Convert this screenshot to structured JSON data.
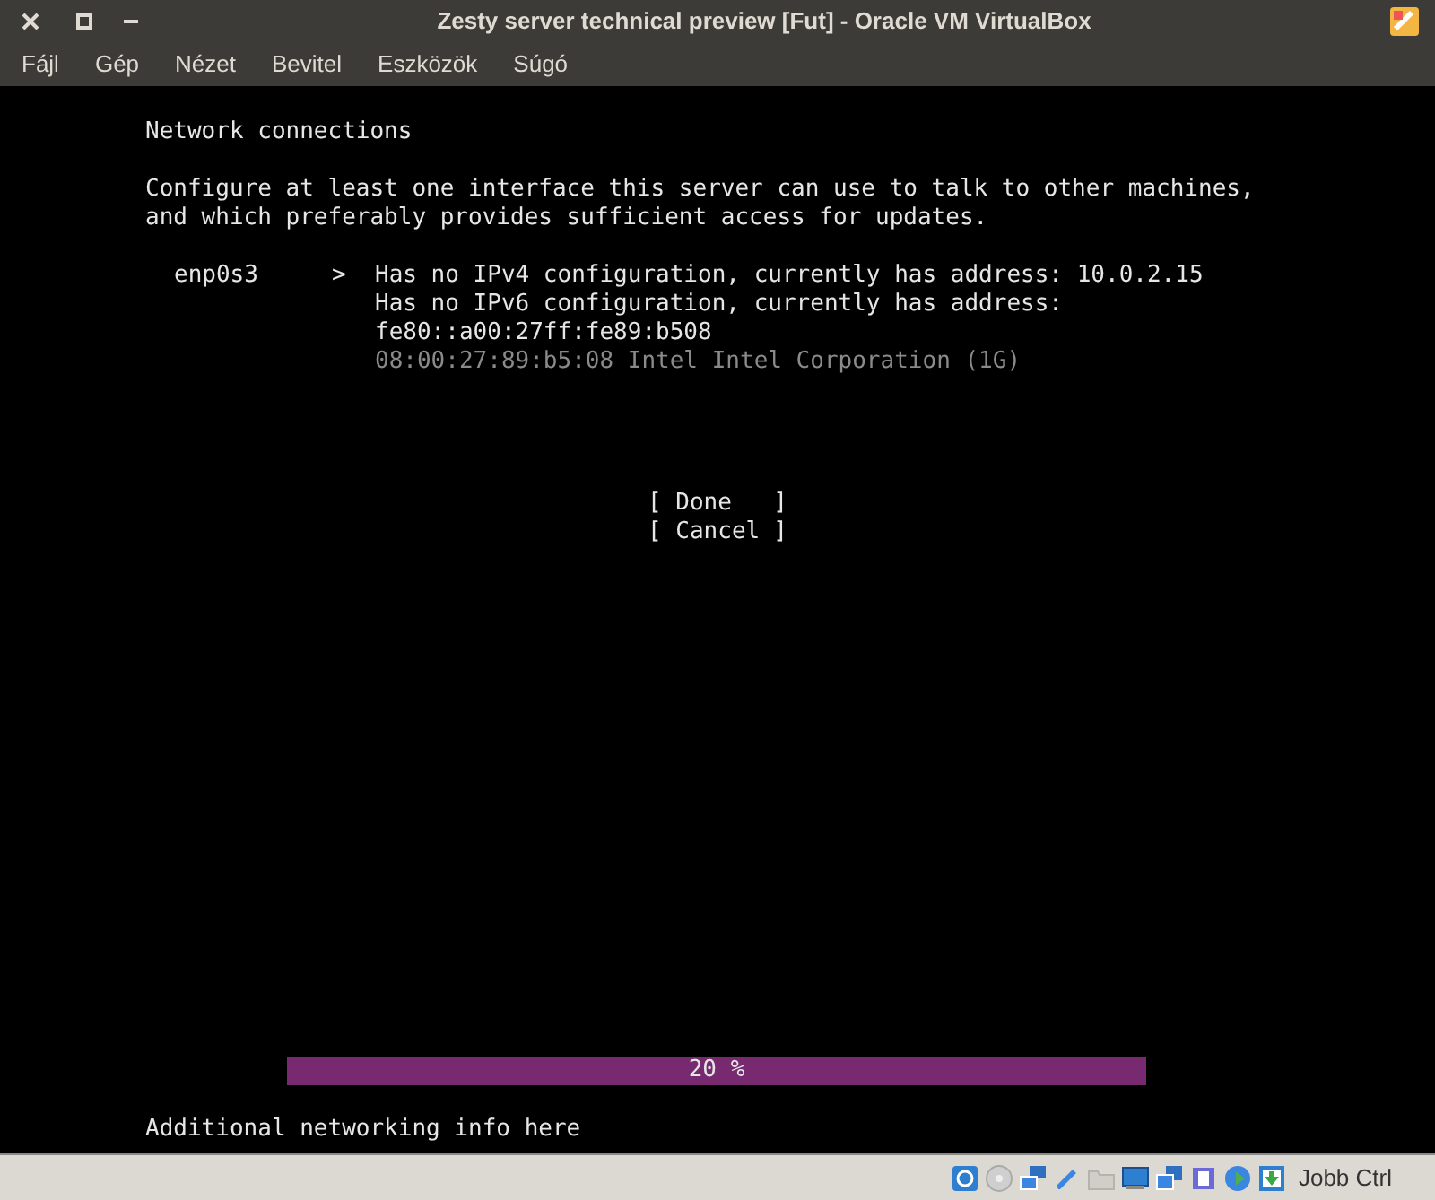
{
  "window": {
    "title": "Zesty server technical preview [Fut] - Oracle VM VirtualBox"
  },
  "menu": [
    "Fájl",
    "Gép",
    "Nézet",
    "Bevitel",
    "Eszközök",
    "Súgó"
  ],
  "screen": {
    "heading": "Network connections",
    "description": [
      "Configure at least one interface this server can use to talk to other machines,",
      "and which preferably provides sufficient access for updates."
    ],
    "interfaces": [
      {
        "name": "enp0s3",
        "arrow": ">",
        "details": [
          {
            "text": "Has no IPv4 configuration, currently has address: 10.0.2.15",
            "kind": "normal"
          },
          {
            "text": "Has no IPv6 configuration, currently has address:",
            "kind": "normal"
          },
          {
            "text": "fe80::a00:27ff:fe89:b508",
            "kind": "normal"
          },
          {
            "text": "08:00:27:89:b5:08 Intel Intel Corporation (1G)",
            "kind": "dim"
          }
        ]
      }
    ],
    "buttons": [
      {
        "open": "[",
        "label": "Done",
        "close": "]"
      },
      {
        "open": "[",
        "label": "Cancel",
        "close": "]"
      }
    ],
    "progress": {
      "text": "20 %",
      "level": 1
    },
    "footer": "Additional networking info here"
  },
  "status_bar": {
    "host_key": "Jobb Ctrl"
  }
}
